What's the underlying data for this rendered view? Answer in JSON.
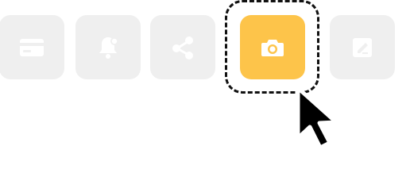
{
  "toolbar": {
    "buttons": [
      {
        "id": "card",
        "icon": "credit-card-icon",
        "active": false
      },
      {
        "id": "bell",
        "icon": "bell-notification-icon",
        "active": false
      },
      {
        "id": "share",
        "icon": "share-icon",
        "active": false
      },
      {
        "id": "camera",
        "icon": "camera-icon",
        "active": true
      },
      {
        "id": "edit",
        "icon": "edit-icon",
        "active": false
      }
    ],
    "focused_button": "camera"
  },
  "colors": {
    "tile_background": "#efefef",
    "icon_fill": "#ffffff",
    "active_accent": "#fdc44a",
    "focus_ring": "#111111",
    "cursor_fill": "#000000",
    "cursor_outline": "#ffffff"
  },
  "pointer": {
    "icon": "mouse-pointer-icon",
    "target": "camera"
  }
}
